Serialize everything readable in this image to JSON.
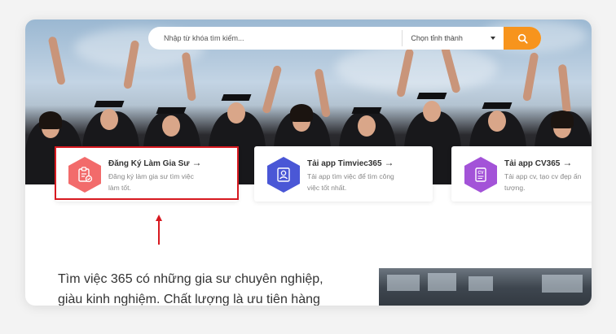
{
  "search": {
    "placeholder": "Nhập từ khóa tìm kiếm...",
    "location_select": "Chọn tỉnh thành"
  },
  "cards": [
    {
      "title": "Đăng Ký Làm Gia Sư",
      "arrow": "→",
      "description": "Đăng ký làm gia sư tìm việc làm tốt.",
      "icon": "clipboard-check-icon",
      "color": "#f26b6b"
    },
    {
      "title": "Tải app Timviec365",
      "arrow": "→",
      "description": "Tải app tìm việc để tìm công việc tốt nhất.",
      "icon": "id-card-icon",
      "color": "#4a57d6"
    },
    {
      "title": "Tải app CV365",
      "arrow": "→",
      "description": "Tải app cv, tạo cv đẹp ấn tượng.",
      "icon": "cv-document-icon",
      "color": "#a353d8"
    }
  ],
  "intro_text": "Tìm việc 365 có những gia sư chuyên nghiệp, giàu kinh nghiệm. Chất lượng là ưu tiên hàng",
  "colors": {
    "accent": "#f7941d",
    "highlight": "#d71920"
  }
}
